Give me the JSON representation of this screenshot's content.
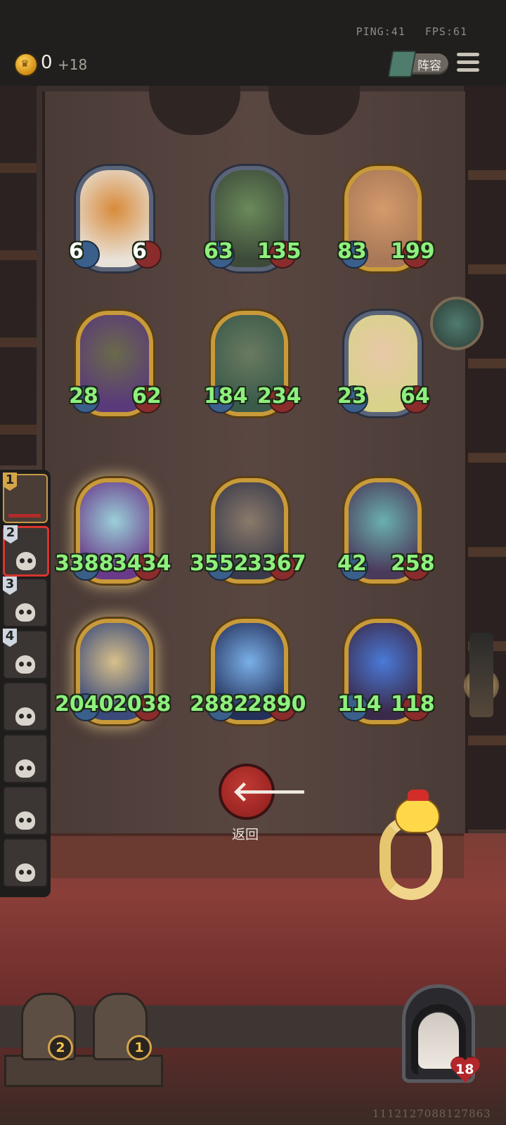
{
  "topbar": {
    "ping": "PING:41",
    "fps": "FPS:61",
    "gold": "0",
    "gold_income": "+18",
    "lineup_label": "阵容"
  },
  "board": {
    "cards": [
      {
        "atk": "6",
        "hp": "6",
        "frame": "silver",
        "portrait_colors": [
          "#e8e2d8",
          "#d88a3a"
        ]
      },
      {
        "atk": "63",
        "hp": "135",
        "frame": "silver",
        "portrait_colors": [
          "#3d4a3a",
          "#6a8a5a"
        ]
      },
      {
        "atk": "83",
        "hp": "199",
        "frame": "gold",
        "portrait_colors": [
          "#a87858",
          "#d49a6a"
        ]
      },
      {
        "atk": "28",
        "hp": "62",
        "frame": "gold",
        "portrait_colors": [
          "#5a3a7a",
          "#6a6a4a"
        ]
      },
      {
        "atk": "184",
        "hp": "234",
        "frame": "gold",
        "portrait_colors": [
          "#3a5a4a",
          "#6a7a60"
        ]
      },
      {
        "atk": "23",
        "hp": "64",
        "frame": "silver",
        "portrait_colors": [
          "#d8d28a",
          "#e8c8a8"
        ]
      },
      {
        "atk": "3388",
        "hp": "3434",
        "frame": "gold",
        "glow": true,
        "portrait_colors": [
          "#6a3a8a",
          "#9ad0d8"
        ]
      },
      {
        "atk": "3552",
        "hp": "3367",
        "frame": "gold",
        "portrait_colors": [
          "#3a3a4a",
          "#8a7a6a"
        ]
      },
      {
        "atk": "42",
        "hp": "258",
        "frame": "gold",
        "portrait_colors": [
          "#4a3a5a",
          "#6ab0b0"
        ]
      },
      {
        "atk": "2040",
        "hp": "2038",
        "frame": "gold",
        "glow": true,
        "portrait_colors": [
          "#3a4a7a",
          "#d8c08a"
        ]
      },
      {
        "atk": "2882",
        "hp": "2890",
        "frame": "gold",
        "portrait_colors": [
          "#24305a",
          "#7ab0e8"
        ]
      },
      {
        "atk": "114",
        "hp": "118",
        "frame": "gold",
        "portrait_colors": [
          "#3a2a4a",
          "#4a7ad8"
        ]
      }
    ]
  },
  "roster": {
    "slots": [
      "1",
      "2",
      "3",
      "4",
      "",
      "",
      "",
      ""
    ]
  },
  "back_button": {
    "label": "返回"
  },
  "chests": [
    {
      "count": "2"
    },
    {
      "count": "1"
    }
  ],
  "player": {
    "health": "18",
    "uid": "1112127088127863"
  }
}
